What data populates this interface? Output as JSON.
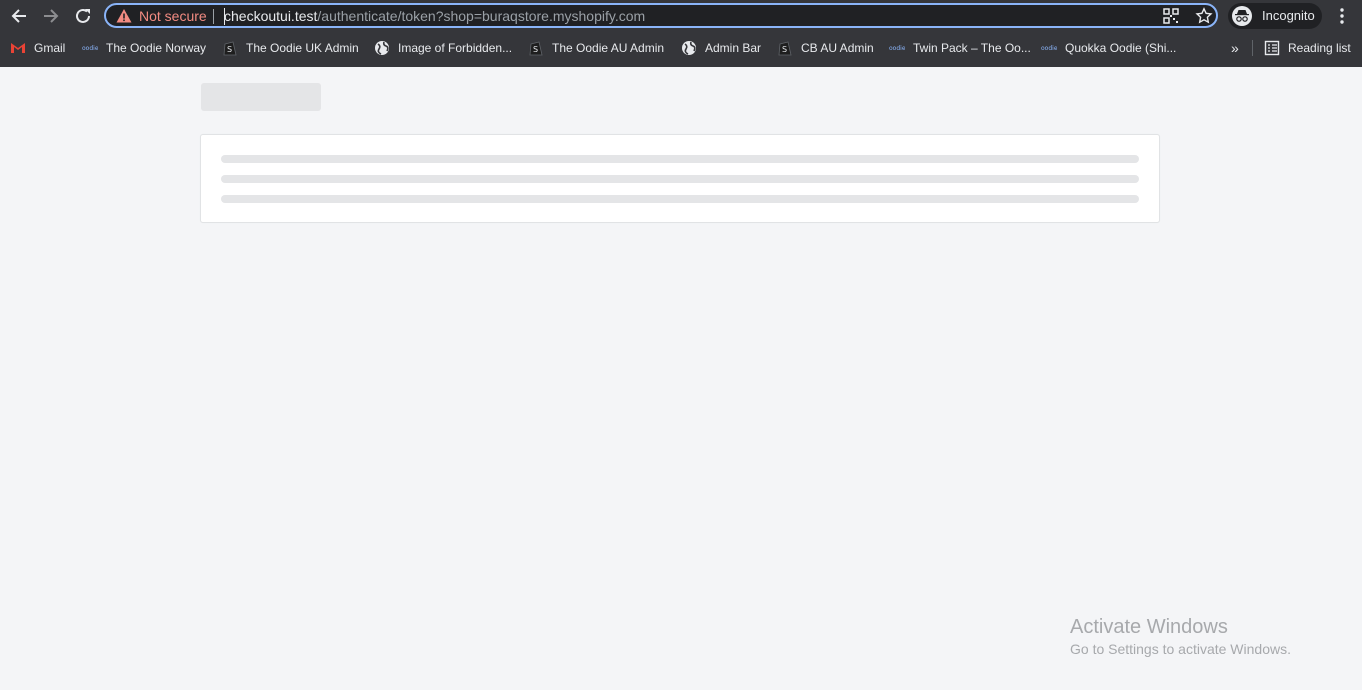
{
  "browser": {
    "omnibox": {
      "security_label": "Not secure",
      "url_host": "checkoutui.test",
      "url_path": "/authenticate/token?shop=buraqstore.myshopify.com"
    },
    "profile_label": "Incognito"
  },
  "bookmarks": {
    "items": [
      {
        "label": "Gmail",
        "icon": "gmail-icon"
      },
      {
        "label": "The Oodie Norway",
        "icon": "oodie-icon"
      },
      {
        "label": "The Oodie UK Admin",
        "icon": "shopify-icon"
      },
      {
        "label": "Image of Forbidden...",
        "icon": "globe-icon"
      },
      {
        "label": "The Oodie AU Admin",
        "icon": "shopify-icon"
      },
      {
        "label": "Admin Bar",
        "icon": "globe-icon"
      },
      {
        "label": "CB AU Admin",
        "icon": "shopify-icon"
      },
      {
        "label": "Twin Pack – The Oo...",
        "icon": "oodie-icon"
      },
      {
        "label": "Quokka Oodie (Shi...",
        "icon": "oodie-icon"
      }
    ],
    "overflow_label": "»",
    "reading_list_label": "Reading list"
  },
  "windows_watermark": {
    "title": "Activate Windows",
    "subtitle": "Go to Settings to activate Windows."
  },
  "colors": {
    "chrome_bg": "#35363a",
    "omnibox_bg": "#202124",
    "focus_ring": "#8ab4f8",
    "warning": "#f28b82",
    "page_bg": "#f4f5f7",
    "skeleton": "#e4e5e7"
  }
}
